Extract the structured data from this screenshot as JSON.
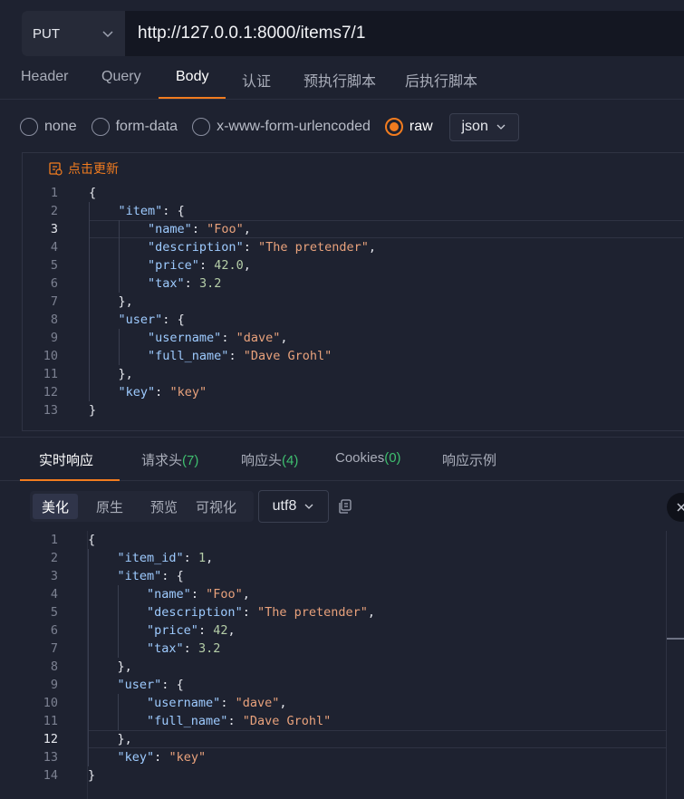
{
  "request": {
    "method": "PUT",
    "url": "http://127.0.0.1:8000/items7/1"
  },
  "req_tabs": [
    {
      "label": "Header",
      "active": false
    },
    {
      "label": "Query",
      "active": false
    },
    {
      "label": "Body",
      "active": true
    },
    {
      "label": "认证",
      "active": false
    },
    {
      "label": "预执行脚本",
      "active": false
    },
    {
      "label": "后执行脚本",
      "active": false
    }
  ],
  "body_types": [
    {
      "label": "none",
      "checked": false
    },
    {
      "label": "form-data",
      "checked": false
    },
    {
      "label": "x-www-form-urlencoded",
      "checked": false
    },
    {
      "label": "raw",
      "checked": true
    }
  ],
  "body_format": "json",
  "editor": {
    "update_label": "点击更新",
    "current_line": 3,
    "lines": [
      "{",
      "    \"item\": {",
      "        \"name\": \"Foo\",",
      "        \"description\": \"The pretender\",",
      "        \"price\": 42.0,",
      "        \"tax\": 3.2",
      "    },",
      "    \"user\": {",
      "        \"username\": \"dave\",",
      "        \"full_name\": \"Dave Grohl\"",
      "    },",
      "    \"key\": \"key\"",
      "}"
    ]
  },
  "resp_tabs": [
    {
      "label": "实时响应",
      "count": "",
      "active": true
    },
    {
      "label": "请求头",
      "count": "(7)",
      "active": false
    },
    {
      "label": "响应头",
      "count": "(4)",
      "active": false
    },
    {
      "label": "Cookies",
      "count": "(0)",
      "active": false
    },
    {
      "label": "响应示例",
      "count": "",
      "active": false
    }
  ],
  "view_modes": [
    {
      "label": "美化",
      "active": true
    },
    {
      "label": "原生",
      "active": false
    },
    {
      "label": "预览",
      "active": false
    },
    {
      "label": "可视化",
      "active": false
    }
  ],
  "encoding": "utf8",
  "response": {
    "current_line": 12,
    "lines": [
      "{",
      "    \"item_id\": 1,",
      "    \"item\": {",
      "        \"name\": \"Foo\",",
      "        \"description\": \"The pretender\",",
      "        \"price\": 42,",
      "        \"tax\": 3.2",
      "    },",
      "    \"user\": {",
      "        \"username\": \"dave\",",
      "        \"full_name\": \"Dave Grohl\"",
      "    },",
      "    \"key\": \"key\"",
      "}"
    ]
  },
  "colors": {
    "accent": "#f27c1f",
    "count_green": "#3fbf6f",
    "json_key": "#9ecbff",
    "json_string": "#e9a27c",
    "json_number": "#b5cea8"
  }
}
